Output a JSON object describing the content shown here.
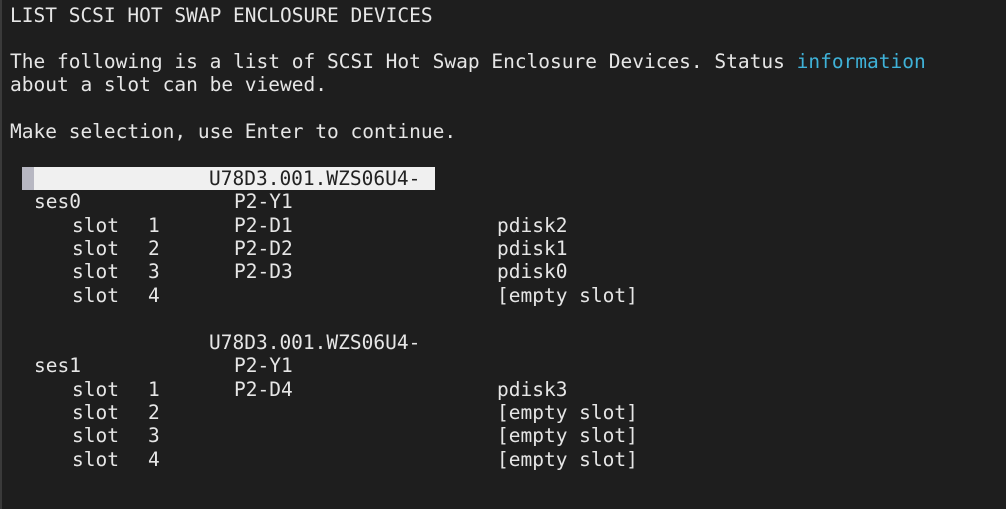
{
  "screen": {
    "title": "LIST SCSI HOT SWAP ENCLOSURE DEVICES",
    "description_part1": "The following is a list of SCSI Hot Swap Enclosure Devices. Status ",
    "description_link": "information",
    "description_part2": "about a slot can be viewed.",
    "instruction": "Make selection, use Enter to continue.",
    "accent_color": "#3fb2d8"
  },
  "enclosures": [
    {
      "location": "U78D3.001.WZS06U4-",
      "name": "ses0",
      "port": "P2-Y1",
      "selected": true,
      "slots": [
        {
          "label": "slot",
          "number": "1",
          "location": "P2-D1",
          "device": "pdisk2"
        },
        {
          "label": "slot",
          "number": "2",
          "location": "P2-D2",
          "device": "pdisk1"
        },
        {
          "label": "slot",
          "number": "3",
          "location": "P2-D3",
          "device": "pdisk0"
        },
        {
          "label": "slot",
          "number": "4",
          "location": "",
          "device": "[empty slot]"
        }
      ]
    },
    {
      "location": "U78D3.001.WZS06U4-",
      "name": "ses1",
      "port": "P2-Y1",
      "selected": false,
      "slots": [
        {
          "label": "slot",
          "number": "1",
          "location": "P2-D4",
          "device": "pdisk3"
        },
        {
          "label": "slot",
          "number": "2",
          "location": "",
          "device": "[empty slot]"
        },
        {
          "label": "slot",
          "number": "3",
          "location": "",
          "device": "[empty slot]"
        },
        {
          "label": "slot",
          "number": "4",
          "location": "",
          "device": "[empty slot]"
        }
      ]
    }
  ]
}
